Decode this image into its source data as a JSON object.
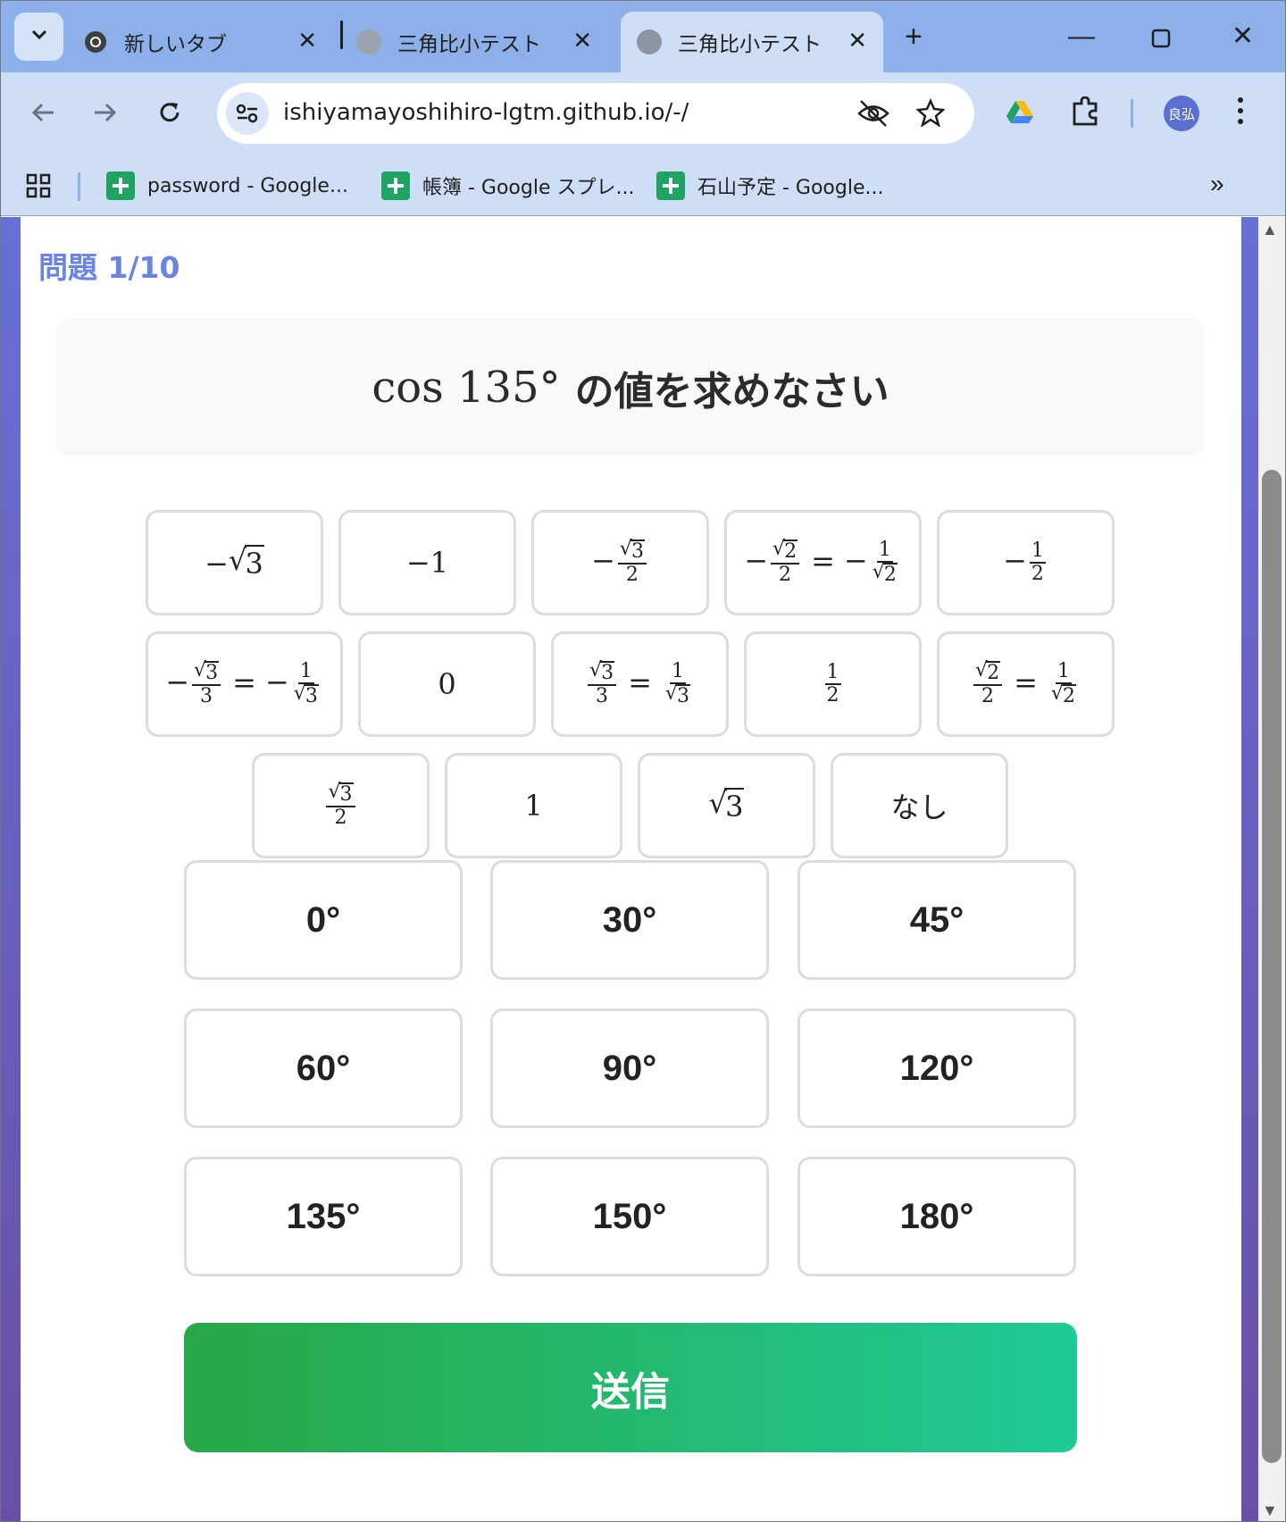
{
  "browser": {
    "tabs": [
      {
        "label": "新しいタブ",
        "active": false
      },
      {
        "label": "三角比小テスト",
        "active": false
      },
      {
        "label": "三角比小テスト",
        "active": true
      }
    ],
    "url": "ishiyamayoshihiro-lgtm.github.io/-/",
    "profile_initials": "良弘",
    "bookmarks": [
      {
        "label": "password - Google..."
      },
      {
        "label": "帳簿 - Google スプレ..."
      },
      {
        "label": "石山予定 - Google..."
      }
    ]
  },
  "quiz": {
    "progress": "問題 1/10",
    "question_math": "cos 135°",
    "question_text": "の値を求めなさい",
    "answers_text": [
      "−1",
      "0",
      "1",
      "なし"
    ],
    "angles": [
      "0°",
      "30°",
      "45°",
      "60°",
      "90°",
      "120°",
      "135°",
      "150°",
      "180°"
    ],
    "submit_label": "送信"
  },
  "colors": {
    "progress": "#6a83e6",
    "submit_start": "#28a846",
    "submit_end": "#20c997",
    "background_gradient_top": "#6770d6",
    "background_gradient_bottom": "#6a4fa6"
  }
}
